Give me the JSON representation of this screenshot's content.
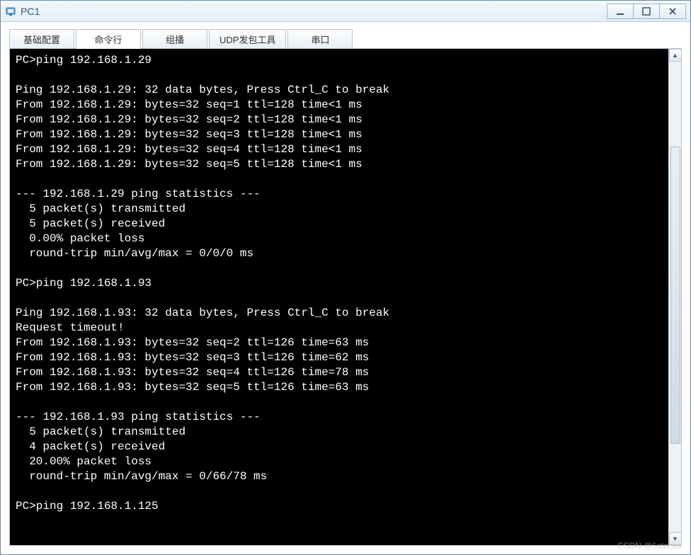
{
  "window": {
    "title": "PC1"
  },
  "tabs": [
    {
      "label": "基础配置",
      "active": false
    },
    {
      "label": "命令行",
      "active": true
    },
    {
      "label": "组播",
      "active": false
    },
    {
      "label": "UDP发包工具",
      "active": false
    },
    {
      "label": "串口",
      "active": false
    }
  ],
  "terminal": {
    "prompt": "PC>",
    "lines": [
      "PC>ping 192.168.1.29",
      "",
      "Ping 192.168.1.29: 32 data bytes, Press Ctrl_C to break",
      "From 192.168.1.29: bytes=32 seq=1 ttl=128 time<1 ms",
      "From 192.168.1.29: bytes=32 seq=2 ttl=128 time<1 ms",
      "From 192.168.1.29: bytes=32 seq=3 ttl=128 time<1 ms",
      "From 192.168.1.29: bytes=32 seq=4 ttl=128 time<1 ms",
      "From 192.168.1.29: bytes=32 seq=5 ttl=128 time<1 ms",
      "",
      "--- 192.168.1.29 ping statistics ---",
      "  5 packet(s) transmitted",
      "  5 packet(s) received",
      "  0.00% packet loss",
      "  round-trip min/avg/max = 0/0/0 ms",
      "",
      "PC>ping 192.168.1.93",
      "",
      "Ping 192.168.1.93: 32 data bytes, Press Ctrl_C to break",
      "Request timeout!",
      "From 192.168.1.93: bytes=32 seq=2 ttl=126 time=63 ms",
      "From 192.168.1.93: bytes=32 seq=3 ttl=126 time=62 ms",
      "From 192.168.1.93: bytes=32 seq=4 ttl=126 time=78 ms",
      "From 192.168.1.93: bytes=32 seq=5 ttl=126 time=63 ms",
      "",
      "--- 192.168.1.93 ping statistics ---",
      "  5 packet(s) transmitted",
      "  4 packet(s) received",
      "  20.00% packet loss",
      "  round-trip min/avg/max = 0/66/78 ms",
      "",
      "PC>ping 192.168.1.125"
    ]
  },
  "watermark": "CSDN @5stacks"
}
